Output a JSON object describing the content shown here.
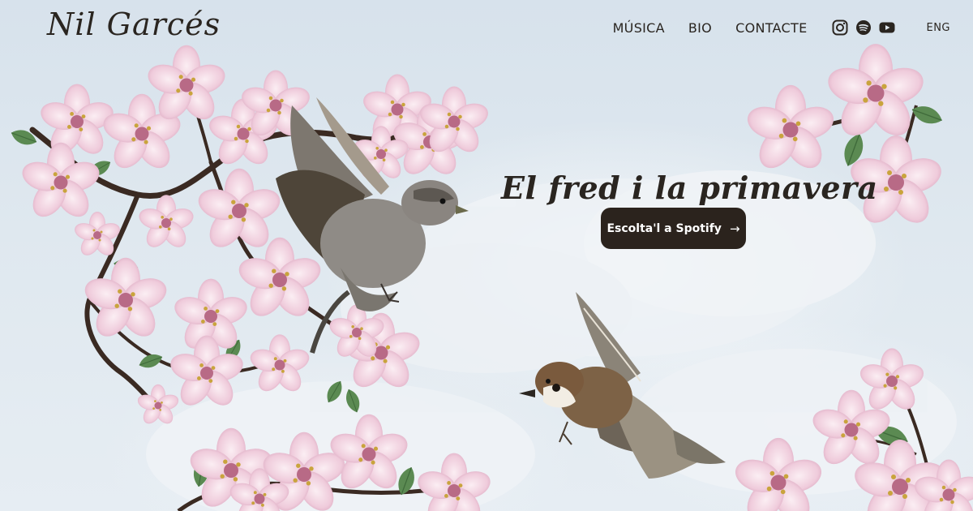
{
  "brand": {
    "logo_text": "Nil Garcés"
  },
  "nav": {
    "items": [
      {
        "label": "MÚSICA"
      },
      {
        "label": "BIO"
      },
      {
        "label": "CONTACTE"
      }
    ],
    "social": [
      {
        "icon": "instagram-icon"
      },
      {
        "icon": "spotify-icon"
      },
      {
        "icon": "youtube-icon"
      }
    ],
    "language": "ENG"
  },
  "hero": {
    "title": "El fred i la primavera",
    "cta_label": "Escolta'l a Spotify",
    "cta_icon": "arrow-right-icon"
  },
  "colors": {
    "text": "#2a2520",
    "button_bg": "#2b231d",
    "button_text": "#ffffff",
    "sky": "#d7e2ec",
    "blossom": "#ecc7d7",
    "leaf": "#5b8a52",
    "branch": "#3a2a22"
  }
}
